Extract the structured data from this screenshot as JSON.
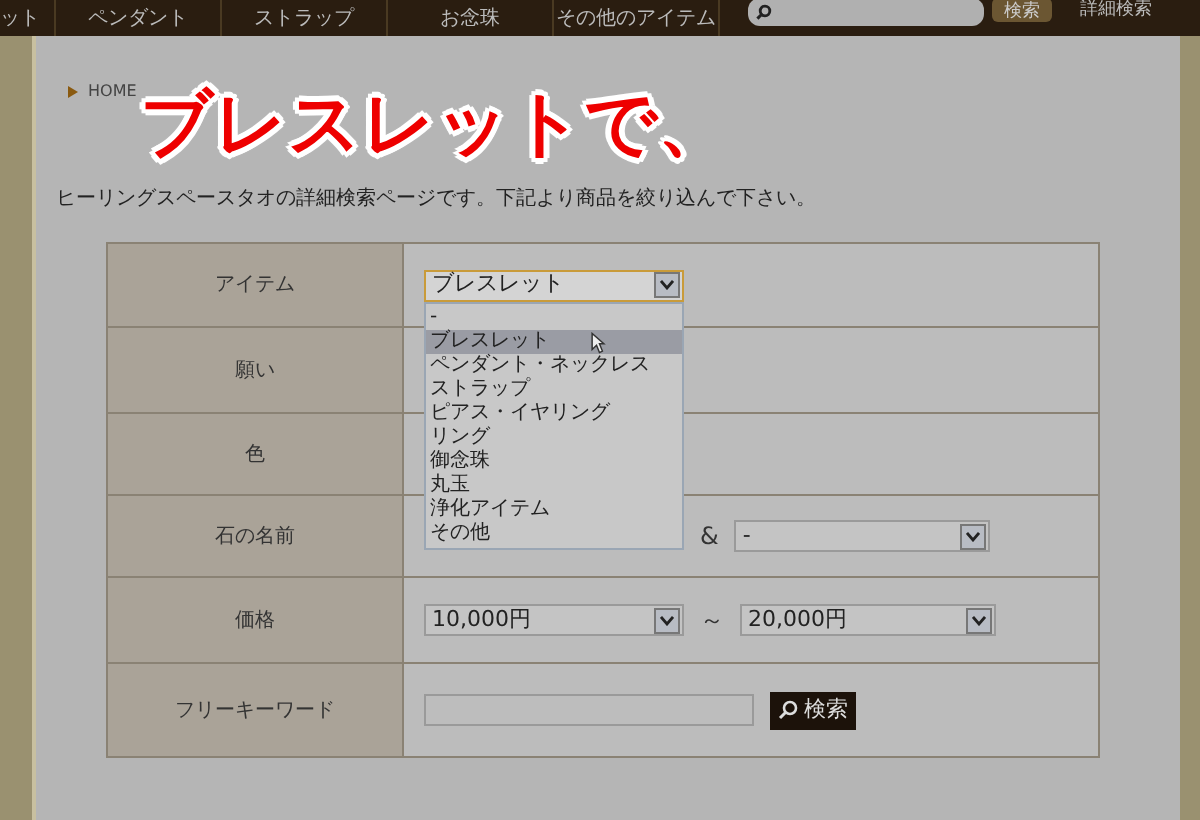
{
  "nav": {
    "items": [
      "ット",
      "ペンダント",
      "ストラップ",
      "お念珠",
      "その他のアイテム"
    ],
    "search_button": "検索",
    "advanced_link": "詳細検索"
  },
  "breadcrumb": [
    "HOME"
  ],
  "caption": "ブレスレットで、",
  "intro": "ヒーリングスペースタオの詳細検索ページです。下記より商品を絞り込んで下さい。",
  "form": {
    "rows": [
      {
        "label": "アイテム",
        "kind": "select",
        "value": "ブレスレット",
        "open": true
      },
      {
        "label": "願い",
        "kind": "blank"
      },
      {
        "label": "色",
        "kind": "blank"
      },
      {
        "label": "石の名前",
        "kind": "pair",
        "separator": "&",
        "second": "-"
      },
      {
        "label": "価格",
        "kind": "range",
        "from": "10,000円",
        "separator": "～",
        "to": "20,000円"
      },
      {
        "label": "フリーキーワード",
        "kind": "keyword",
        "button": "検索"
      }
    ]
  },
  "dropdown": {
    "options": [
      {
        "label": "-",
        "selected": false
      },
      {
        "label": "ブレスレット",
        "selected": true
      },
      {
        "label": "ペンダント・ネックレス",
        "selected": false
      },
      {
        "label": "ストラップ",
        "selected": false
      },
      {
        "label": "ピアス・イヤリング",
        "selected": false
      },
      {
        "label": "リング",
        "selected": false
      },
      {
        "label": "御念珠",
        "selected": false
      },
      {
        "label": "丸玉",
        "selected": false
      },
      {
        "label": "浄化アイテム",
        "selected": false
      },
      {
        "label": "その他",
        "selected": false
      }
    ]
  }
}
